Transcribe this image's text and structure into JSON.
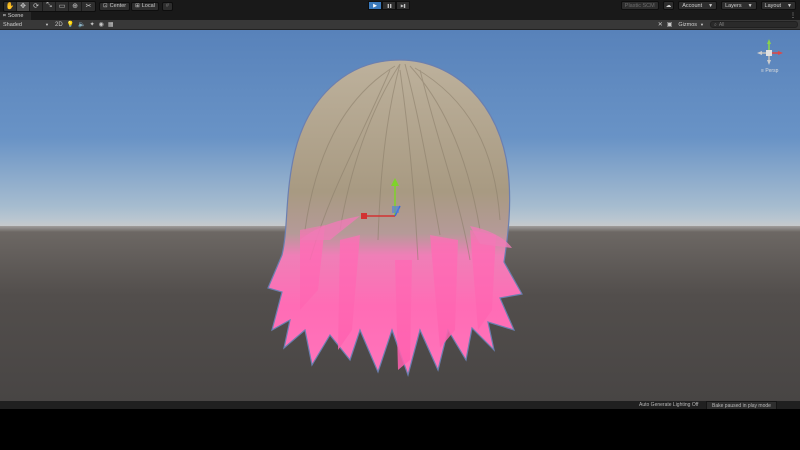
{
  "toolbar": {
    "tools": [
      "hand-tool",
      "move-tool",
      "rotate-tool",
      "scale-tool",
      "rect-tool",
      "transform-tool",
      "custom-tool"
    ],
    "pivot_mode": "Center",
    "pivot_rotation": "Local",
    "snap": "",
    "play": "▶",
    "pause": "❚❚",
    "step": "▶❚",
    "plastic_scm": "Plastic SCM",
    "account": "Account",
    "layers": "Layers",
    "layout": "Layout"
  },
  "tab": {
    "title": "Scene"
  },
  "scene_toolbar": {
    "draw_mode": "Shaded",
    "mode_2d": "2D",
    "gizmos": "Gizmos",
    "search_placeholder": "All"
  },
  "gizmo": {
    "projection": "Persp"
  },
  "status": {
    "lighting": "Auto Generate Lighting Off",
    "bake": "Bake paused in play mode"
  },
  "colors": {
    "sky_top": "#5882ba",
    "ground": "#524e4c",
    "hair_base": "#b2a48c",
    "hair_tip": "#ff6fb6",
    "play_active": "#3a79bb"
  }
}
